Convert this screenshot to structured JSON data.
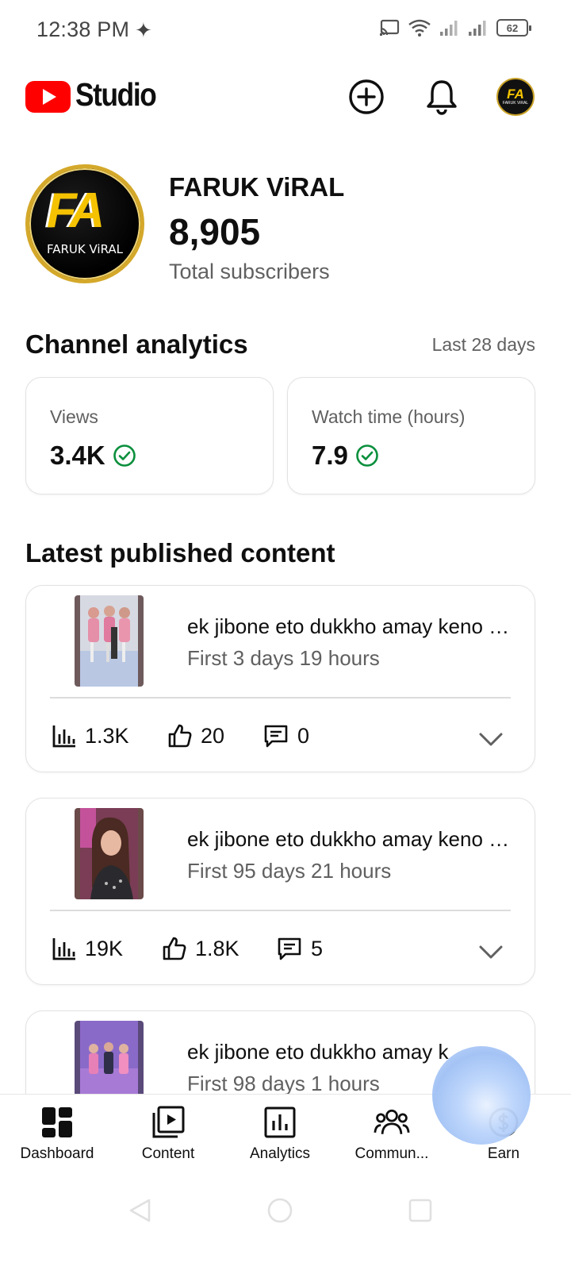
{
  "status_bar": {
    "time": "12:38 PM",
    "battery": "62"
  },
  "header": {
    "app_name": "Studio",
    "icons": [
      "create-icon",
      "notifications-icon",
      "account-avatar"
    ]
  },
  "channel": {
    "avatar_text": "FA",
    "avatar_name": "FARUK ViRAL",
    "name": "FARUK ViRAL",
    "subscribers": "8,905",
    "subscribers_label": "Total subscribers"
  },
  "analytics": {
    "title": "Channel analytics",
    "range": "Last 28 days",
    "stats": [
      {
        "label": "Views",
        "value": "3.4K"
      },
      {
        "label": "Watch time (hours)",
        "value": "7.9"
      }
    ]
  },
  "latest": {
    "title": "Latest published content",
    "items": [
      {
        "title": "ek jibone eto dukkho amay keno tumi dile",
        "subtitle": "First 3 days 19 hours",
        "views": "1.3K",
        "likes": "20",
        "comments": "0"
      },
      {
        "title": "ek jibone eto dukkho amay keno tumi dile",
        "subtitle": "First 95 days 21 hours",
        "views": "19K",
        "likes": "1.8K",
        "comments": "5"
      },
      {
        "title": "ek jibone eto dukkho amay k",
        "subtitle": "First 98 days 1 hours"
      }
    ]
  },
  "bottom_nav": {
    "items": [
      {
        "label": "Dashboard",
        "icon": "dashboard-icon",
        "active": true
      },
      {
        "label": "Content",
        "icon": "content-icon"
      },
      {
        "label": "Analytics",
        "icon": "analytics-icon"
      },
      {
        "label": "Commun...",
        "icon": "community-icon"
      },
      {
        "label": "Earn",
        "icon": "earn-icon"
      }
    ]
  },
  "colors": {
    "brand_red": "#ff0000",
    "check_green": "#0a8f3c",
    "text_secondary": "#606060"
  }
}
